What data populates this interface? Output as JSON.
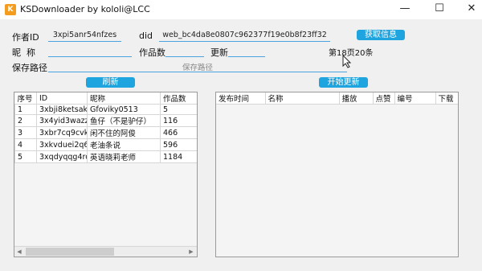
{
  "window": {
    "title": "KSDownloader by kololi@LCC",
    "icon_glyph": "K",
    "minimize_glyph": "—",
    "maximize_glyph": "☐",
    "close_glyph": "✕"
  },
  "form": {
    "author_id_label": "作者ID",
    "author_id_value": "3xpi5anr54nfzes",
    "did_label": "did",
    "did_value": "web_bc4da8e0807c962377f19e0b8f23ff32",
    "fetch_button": "获取信息",
    "nickname_label": "昵  称",
    "nickname_value": "",
    "works_label": "作品数",
    "works_value": "",
    "update_label": "更新",
    "update_value": "",
    "page_status": "第18页20条",
    "save_path_label": "保存路径",
    "save_path_placeholder": "保存路径"
  },
  "buttons": {
    "refresh": "刷新",
    "start_update": "开始更新"
  },
  "left_table": {
    "headers": [
      "序号",
      "ID",
      "昵称",
      "作品数"
    ],
    "rows": [
      [
        "1",
        "3xbji8ketsakg",
        "Gfoviky0513",
        "5"
      ],
      [
        "2",
        "3x4yid3wazz9",
        "鱼仔（不是驴仔）",
        "116"
      ],
      [
        "3",
        "3xbr7cq9cvkc",
        "闲不住的阿俊",
        "466"
      ],
      [
        "4",
        "3xkvduei2q66",
        "老油条说",
        "596"
      ],
      [
        "5",
        "3xqdyqqg4rq",
        "英语晓莉老师",
        "1184"
      ]
    ]
  },
  "right_table": {
    "headers": [
      "发布时间",
      "名称",
      "播放",
      "点赞",
      "编号",
      "下载"
    ],
    "rows": []
  },
  "colors": {
    "accent": "#1ea4df",
    "field_underline": "#4aa3df",
    "app_icon": "#f39c1d"
  }
}
